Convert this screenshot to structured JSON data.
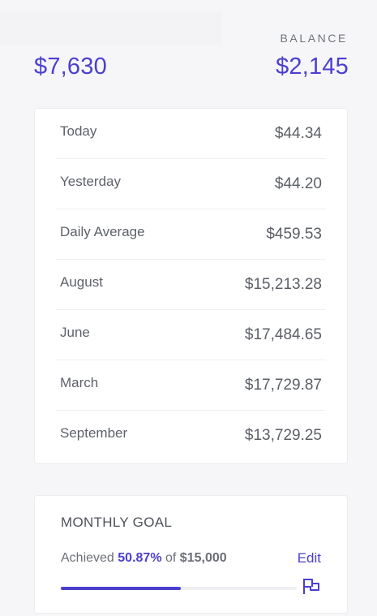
{
  "header": {
    "balance_label": "BALANCE",
    "amount_left": "$7,630",
    "amount_right": "$2,145"
  },
  "stats": [
    {
      "label": "Today",
      "value": "$44.34"
    },
    {
      "label": "Yesterday",
      "value": "$44.20"
    },
    {
      "label": "Daily Average",
      "value": "$459.53"
    },
    {
      "label": "August",
      "value": "$15,213.28"
    },
    {
      "label": "June",
      "value": "$17,484.65"
    },
    {
      "label": "March",
      "value": "$17,729.87"
    },
    {
      "label": "September",
      "value": "$13,729.25"
    }
  ],
  "goal": {
    "title": "MONTHLY GOAL",
    "achieved_prefix": "Achieved",
    "percent": "50.87%",
    "of_text": "of",
    "target": "$15,000",
    "edit_label": "Edit",
    "progress": 0.5087,
    "icon": "flag-icon"
  },
  "colors": {
    "accent": "#4b3fcf",
    "background": "#f6f6f8",
    "card": "#ffffff"
  }
}
